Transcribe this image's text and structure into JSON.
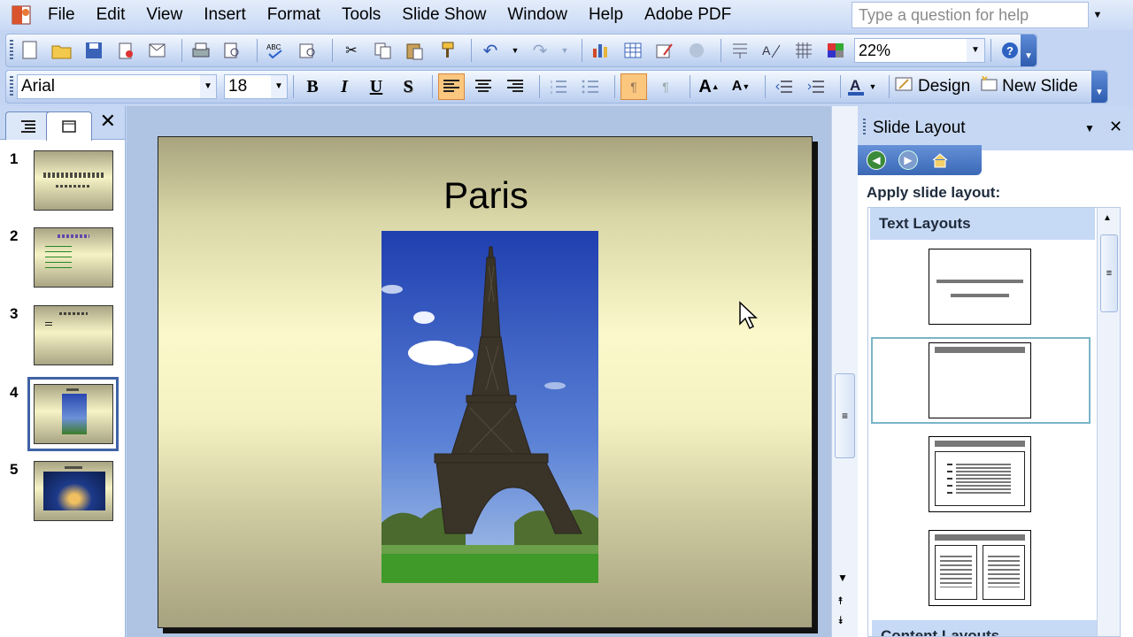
{
  "menu": {
    "items": [
      "File",
      "Edit",
      "View",
      "Insert",
      "Format",
      "Tools",
      "Slide Show",
      "Window",
      "Help",
      "Adobe PDF"
    ],
    "help_placeholder": "Type a question for help"
  },
  "standard_toolbar": {
    "zoom": "22%"
  },
  "formatting_toolbar": {
    "font": "Arial",
    "size": "18",
    "bold": "B",
    "italic": "I",
    "underline": "U",
    "shadow": "S",
    "design_label": "Design",
    "new_slide_label": "New Slide"
  },
  "slides_panel": {
    "thumbnails": [
      {
        "number": "1"
      },
      {
        "number": "2"
      },
      {
        "number": "3"
      },
      {
        "number": "4"
      },
      {
        "number": "5"
      }
    ],
    "selected": 4
  },
  "slide": {
    "title": "Paris"
  },
  "task_pane": {
    "title": "Slide Layout",
    "apply_label": "Apply slide layout:",
    "categories": [
      "Text Layouts",
      "Content Layouts"
    ]
  },
  "colors": {
    "accent": "#3b68b6",
    "toolbar_bg": "#cfdef6",
    "active_button": "#fbc77f"
  }
}
